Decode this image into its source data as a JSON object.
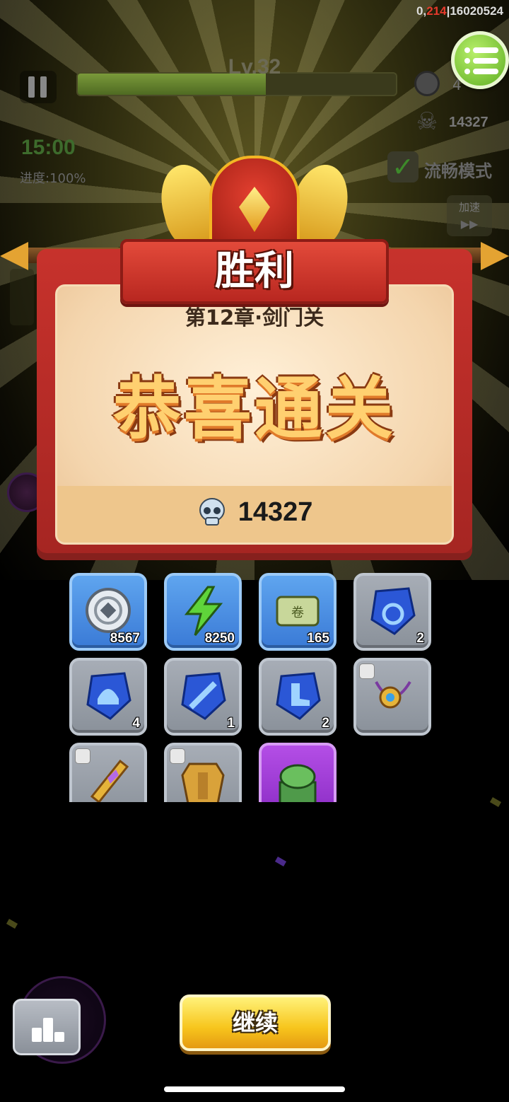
{
  "status": {
    "debug_prefix": "0,",
    "debug_highlight": "214",
    "debug_suffix": "|16020524"
  },
  "hud": {
    "level_label": "Lv.32",
    "level_progress": 0.59,
    "coins_partial": "4",
    "skull_count": "14327",
    "timer": "15:00",
    "progress_text": "进度:100%",
    "smooth_mode_label": "流畅模式",
    "smooth_mode_checked": true,
    "speed_label": "加速",
    "speed_icon": "fast-forward-icon",
    "menu_icon": "list-menu-icon"
  },
  "victory": {
    "title": "胜利",
    "chapter": "第12章·剑门关",
    "congrats": "恭喜通关",
    "score_icon": "skull-icon",
    "score": "14327"
  },
  "rewards": [
    {
      "name": "silver-coin",
      "icon": "coin-icon",
      "qty": "8567",
      "rarity": "blue"
    },
    {
      "name": "energy",
      "icon": "lightning-icon",
      "qty": "8250",
      "rarity": "blue"
    },
    {
      "name": "scroll",
      "icon": "scroll-icon",
      "qty": "165",
      "rarity": "blue"
    },
    {
      "name": "necklace-gem",
      "icon": "amulet-gem-icon",
      "qty": "2",
      "rarity": "gray"
    },
    {
      "name": "helmet-gem",
      "icon": "helmet-gem-icon",
      "qty": "4",
      "rarity": "gray"
    },
    {
      "name": "weapon-gem",
      "icon": "sword-gem-icon",
      "qty": "1",
      "rarity": "gray"
    },
    {
      "name": "boots-gem",
      "icon": "boot-gem-icon",
      "qty": "2",
      "rarity": "gray"
    },
    {
      "name": "amulet",
      "icon": "amulet-icon",
      "qty": "",
      "rarity": "gray"
    },
    {
      "name": "sword-hilt",
      "icon": "sword-icon",
      "qty": "",
      "rarity": "gray"
    },
    {
      "name": "armor",
      "icon": "armor-icon",
      "qty": "",
      "rarity": "gray"
    },
    {
      "name": "jade-seal",
      "icon": "turtle-seal-icon",
      "qty": "",
      "rarity": "purple"
    }
  ],
  "footer": {
    "continue_label": "继续",
    "rank_icon": "leaderboard-icon"
  },
  "colors": {
    "accent_red": "#c7322c",
    "button_yellow": "#f7c51c",
    "rarity_blue": "#3a7ad6",
    "rarity_purple": "#8a2cc4",
    "rarity_gray": "#8a919a"
  }
}
